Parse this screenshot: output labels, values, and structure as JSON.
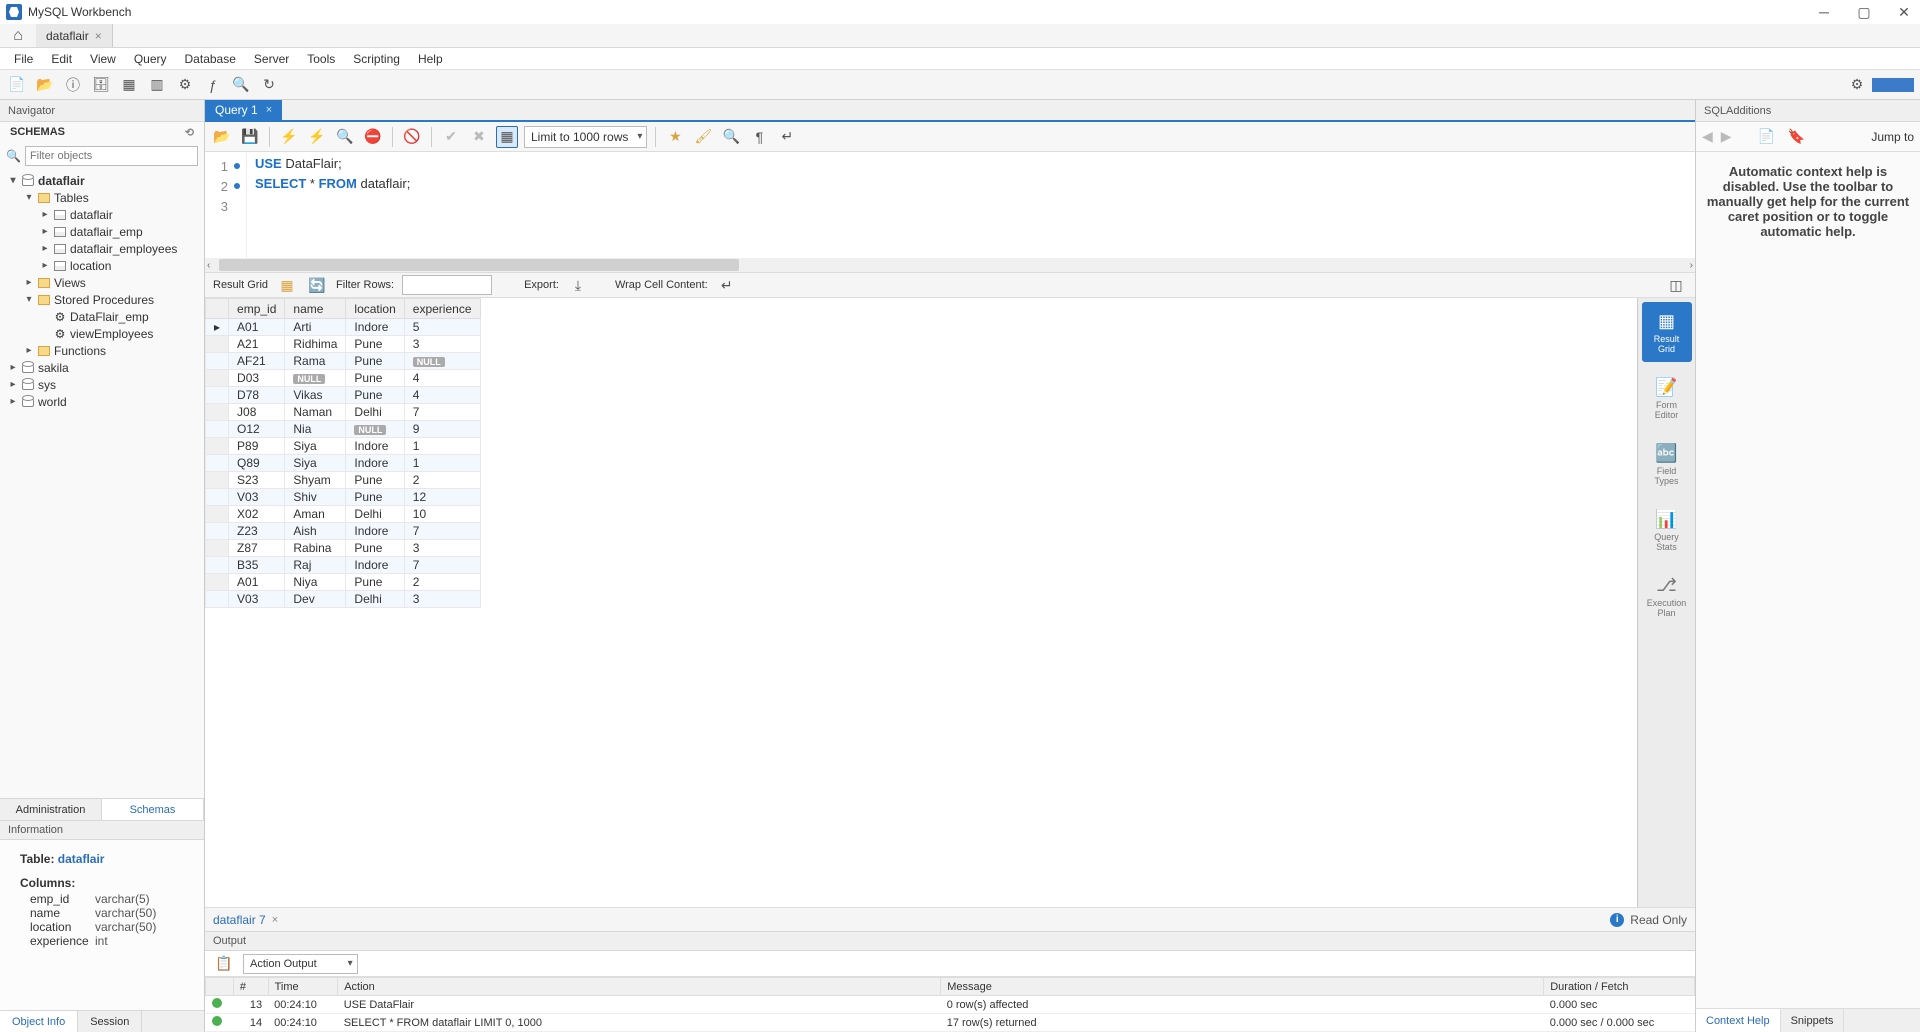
{
  "app": {
    "title": "MySQL Workbench"
  },
  "conn_tab": "dataflair",
  "menu": [
    "File",
    "Edit",
    "View",
    "Query",
    "Database",
    "Server",
    "Tools",
    "Scripting",
    "Help"
  ],
  "navigator": {
    "title": "Navigator",
    "schemas_label": "SCHEMAS",
    "filter_placeholder": "Filter objects",
    "tree": {
      "db": "dataflair",
      "tables_label": "Tables",
      "tables": [
        "dataflair",
        "dataflair_emp",
        "dataflair_employees",
        "location"
      ],
      "views_label": "Views",
      "sp_label": "Stored Procedures",
      "sps": [
        "DataFlair_emp",
        "viewEmployees"
      ],
      "fn_label": "Functions",
      "others": [
        "sakila",
        "sys",
        "world"
      ]
    },
    "tabs": {
      "administration": "Administration",
      "schemas": "Schemas"
    },
    "info_label": "Information",
    "info": {
      "table_prefix": "Table: ",
      "table_name": "dataflair",
      "columns_hdr": "Columns:",
      "columns": [
        {
          "name": "emp_id",
          "type": "varchar(5)"
        },
        {
          "name": "name",
          "type": "varchar(50)"
        },
        {
          "name": "location",
          "type": "varchar(50)"
        },
        {
          "name": "experience",
          "type": "int"
        }
      ]
    },
    "bottom_tabs": {
      "object_info": "Object Info",
      "session": "Session"
    }
  },
  "query": {
    "tab": "Query 1",
    "limit": "Limit to 1000 rows",
    "lines": [
      {
        "n": "1",
        "bp": true,
        "html": "<span class='kw'>USE</span> DataFlair;"
      },
      {
        "n": "2",
        "bp": true,
        "html": "<span class='kw'>SELECT</span> * <span class='kw'>FROM</span> dataflair;"
      },
      {
        "n": "3",
        "bp": false,
        "html": ""
      }
    ]
  },
  "result": {
    "toolbar": {
      "grid": "Result Grid",
      "filter": "Filter Rows:",
      "export": "Export:",
      "wrap": "Wrap Cell Content:"
    },
    "headers": [
      "emp_id",
      "name",
      "location",
      "experience"
    ],
    "rows": [
      [
        "A01",
        "Arti",
        "Indore",
        "5"
      ],
      [
        "A21",
        "Ridhima",
        "Pune",
        "3"
      ],
      [
        "AF21",
        "Rama",
        "Pune",
        "__NULL__"
      ],
      [
        "D03",
        "__NULL__",
        "Pune",
        "4"
      ],
      [
        "D78",
        "Vikas",
        "Pune",
        "4"
      ],
      [
        "J08",
        "Naman",
        "Delhi",
        "7"
      ],
      [
        "O12",
        "Nia",
        "__NULL__",
        "9"
      ],
      [
        "P89",
        "Siya",
        "Indore",
        "1"
      ],
      [
        "Q89",
        "Siya",
        "Indore",
        "1"
      ],
      [
        "S23",
        "Shyam",
        "Pune",
        "2"
      ],
      [
        "V03",
        "Shiv",
        "Pune",
        "12"
      ],
      [
        "X02",
        "Aman",
        "Delhi",
        "10"
      ],
      [
        "Z23",
        "Aish",
        "Indore",
        "7"
      ],
      [
        "Z87",
        "Rabina",
        "Pune",
        "3"
      ],
      [
        "B35",
        "Raj",
        "Indore",
        "7"
      ],
      [
        "A01",
        "Niya",
        "Pune",
        "2"
      ],
      [
        "V03",
        "Dev",
        "Delhi",
        "3"
      ]
    ],
    "side": [
      "Result Grid",
      "Form Editor",
      "Field Types",
      "Query Stats",
      "Execution Plan"
    ],
    "tab": "dataflair 7",
    "readonly": "Read Only"
  },
  "output": {
    "label": "Output",
    "selector": "Action Output",
    "headers": [
      "",
      "#",
      "Time",
      "Action",
      "Message",
      "Duration / Fetch"
    ],
    "rows": [
      {
        "n": "13",
        "time": "00:24:10",
        "action": "USE DataFlair",
        "msg": "0 row(s) affected",
        "dur": "0.000 sec"
      },
      {
        "n": "14",
        "time": "00:24:10",
        "action": "SELECT * FROM dataflair LIMIT 0, 1000",
        "msg": "17 row(s) returned",
        "dur": "0.000 sec / 0.000 sec"
      }
    ]
  },
  "right": {
    "title": "SQLAdditions",
    "jump": "Jump to",
    "body": "Automatic context help is disabled. Use the toolbar to manually get help for the current caret position or to toggle automatic help.",
    "tabs": {
      "context": "Context Help",
      "snippets": "Snippets"
    }
  }
}
